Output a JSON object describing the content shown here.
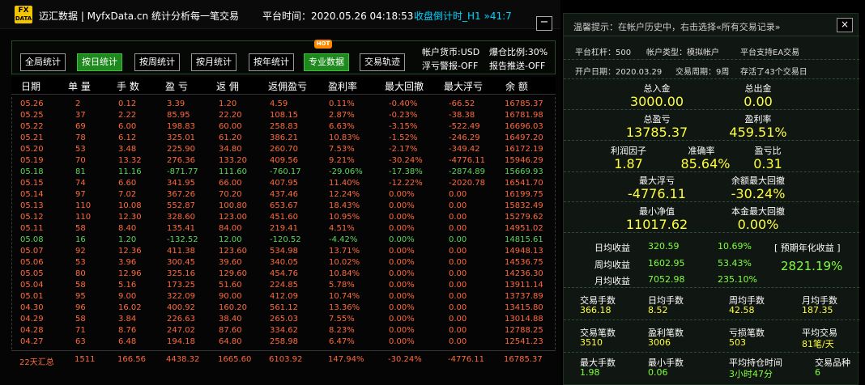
{
  "header": {
    "logo_top": "FX",
    "logo_bottom": "DATA",
    "app_title": "迈汇数据 | MyfxData.cn   统计分析每一笔交易",
    "platform_time": "平台时间：2020.05.26 04:18:53",
    "ea_timer": "收盘倒计时_H1 »41:7",
    "minimize_label": "−"
  },
  "toolbar": {
    "buttons": [
      {
        "label": "全局统计",
        "active": false
      },
      {
        "label": "按日统计",
        "active": true
      },
      {
        "label": "按周统计",
        "active": false
      },
      {
        "label": "按月统计",
        "active": false
      },
      {
        "label": "按年统计",
        "active": false
      },
      {
        "label": "专业数据",
        "active": true
      },
      {
        "label": "交易轨迹",
        "active": false
      }
    ],
    "hot_badge": "HOT",
    "currency": "帐户货币:USD",
    "margin_ratio": "爆仓比例:30%",
    "float_alert": "浮亏警报-OFF",
    "report_push": "报告推送-OFF"
  },
  "columns": [
    "日期",
    "单 量",
    "手 数",
    "盈 亏",
    "返 佣",
    "返佣盈亏",
    "盈利率",
    "最大回撤",
    "最大浮亏",
    "余 额"
  ],
  "rows": [
    {
      "type": "profit",
      "cells": [
        "05.26",
        "2",
        "0.12",
        "3.39",
        "1.20",
        "4.59",
        "0.11%",
        "-0.40%",
        "-66.52",
        "16785.37"
      ]
    },
    {
      "type": "profit",
      "cells": [
        "05.25",
        "37",
        "2.22",
        "85.95",
        "22.20",
        "108.15",
        "2.87%",
        "-0.23%",
        "-38.38",
        "16781.98"
      ]
    },
    {
      "type": "profit",
      "cells": [
        "05.22",
        "69",
        "6.00",
        "198.83",
        "60.00",
        "258.83",
        "6.63%",
        "-3.15%",
        "-522.49",
        "16696.03"
      ]
    },
    {
      "type": "profit",
      "cells": [
        "05.21",
        "78",
        "6.12",
        "325.01",
        "61.20",
        "386.21",
        "10.83%",
        "-1.52%",
        "-246.29",
        "16497.20"
      ]
    },
    {
      "type": "profit",
      "cells": [
        "05.20",
        "53",
        "3.48",
        "225.90",
        "34.80",
        "260.70",
        "7.53%",
        "-2.17%",
        "-349.42",
        "16172.19"
      ]
    },
    {
      "type": "profit",
      "cells": [
        "05.19",
        "70",
        "13.32",
        "276.36",
        "133.20",
        "409.56",
        "9.21%",
        "-30.24%",
        "-4776.11",
        "15946.29"
      ]
    },
    {
      "type": "loss",
      "cells": [
        "05.18",
        "81",
        "11.16",
        "-871.77",
        "111.60",
        "-760.17",
        "-29.06%",
        "-17.38%",
        "-2874.89",
        "15669.93"
      ]
    },
    {
      "type": "profit",
      "cells": [
        "05.15",
        "74",
        "6.60",
        "341.95",
        "66.00",
        "407.95",
        "11.40%",
        "-12.22%",
        "-2020.78",
        "16541.70"
      ]
    },
    {
      "type": "profit",
      "cells": [
        "05.14",
        "97",
        "7.02",
        "367.26",
        "70.20",
        "437.46",
        "12.24%",
        "0.00%",
        "0.00",
        "16199.75"
      ]
    },
    {
      "type": "profit",
      "cells": [
        "05.13",
        "110",
        "10.08",
        "552.87",
        "100.80",
        "653.67",
        "18.43%",
        "0.00%",
        "0.00",
        "15832.49"
      ]
    },
    {
      "type": "profit",
      "cells": [
        "05.12",
        "110",
        "12.30",
        "328.60",
        "123.00",
        "451.60",
        "10.95%",
        "0.00%",
        "0.00",
        "15279.62"
      ]
    },
    {
      "type": "profit",
      "cells": [
        "05.11",
        "58",
        "8.40",
        "135.41",
        "84.00",
        "219.41",
        "4.51%",
        "0.00%",
        "0.00",
        "14951.02"
      ]
    },
    {
      "type": "loss",
      "cells": [
        "05.08",
        "16",
        "1.20",
        "-132.52",
        "12.00",
        "-120.52",
        "-4.42%",
        "0.00%",
        "0.00",
        "14815.61"
      ]
    },
    {
      "type": "profit",
      "cells": [
        "05.07",
        "92",
        "12.36",
        "411.38",
        "123.60",
        "534.98",
        "13.71%",
        "0.00%",
        "0.00",
        "14948.13"
      ]
    },
    {
      "type": "profit",
      "cells": [
        "05.06",
        "53",
        "3.96",
        "300.45",
        "39.60",
        "340.05",
        "10.02%",
        "0.00%",
        "0.00",
        "14536.75"
      ]
    },
    {
      "type": "profit",
      "cells": [
        "05.05",
        "80",
        "12.96",
        "325.16",
        "129.60",
        "454.76",
        "10.84%",
        "0.00%",
        "0.00",
        "14236.30"
      ]
    },
    {
      "type": "profit",
      "cells": [
        "05.04",
        "58",
        "5.16",
        "173.25",
        "51.60",
        "224.85",
        "5.78%",
        "0.00%",
        "0.00",
        "13911.14"
      ]
    },
    {
      "type": "profit",
      "cells": [
        "05.01",
        "95",
        "9.00",
        "322.09",
        "90.00",
        "412.09",
        "10.74%",
        "0.00%",
        "0.00",
        "13737.89"
      ]
    },
    {
      "type": "profit",
      "cells": [
        "04.30",
        "96",
        "16.02",
        "400.92",
        "160.20",
        "561.12",
        "13.36%",
        "0.00%",
        "0.00",
        "13415.80"
      ]
    },
    {
      "type": "profit",
      "cells": [
        "04.29",
        "58",
        "3.84",
        "226.63",
        "38.40",
        "265.03",
        "7.55%",
        "0.00%",
        "0.00",
        "13014.88"
      ]
    },
    {
      "type": "profit",
      "cells": [
        "04.28",
        "71",
        "8.76",
        "247.02",
        "87.60",
        "334.62",
        "8.23%",
        "0.00%",
        "0.00",
        "12788.25"
      ]
    },
    {
      "type": "profit",
      "cells": [
        "04.27",
        "63",
        "6.48",
        "194.18",
        "64.80",
        "258.98",
        "6.47%",
        "0.00%",
        "0.00",
        "12541.23"
      ]
    }
  ],
  "footer": [
    "22天汇总",
    "1511",
    "166.56",
    "4438.32",
    "1665.60",
    "6103.92",
    "147.94%",
    "-30.24%",
    "-4776.11",
    "16785.37"
  ],
  "right": {
    "tip": "温馨提示：在帐户历史中，右击选择«所有交易记录»",
    "close_label": "×",
    "leverage": "平台杠杆：500",
    "account_type": "帐户类型：模拟帐户",
    "ea_support": "平台支持EA交易",
    "open_date": "开户日期：2020.03.29",
    "trade_period": "交易周期：9周",
    "alive": "存活了43个交易日",
    "deposit_label": "总入金",
    "deposit": "3000.00",
    "withdraw_label": "总出金",
    "withdraw": "0.00",
    "profit_label": "总盈亏",
    "profit": "13785.37",
    "profit_rate_label": "盈利率",
    "profit_rate": "459.51%",
    "pf_label": "利润因子",
    "pf": "1.87",
    "acc_label": "准确率",
    "acc": "85.64%",
    "pl_ratio_label": "盈亏比",
    "pl_ratio": "0.31",
    "max_float_label": "最大浮亏",
    "max_float": "-4776.11",
    "max_dd_label": "余额最大回撤",
    "max_dd": "-30.24%",
    "min_equity_label": "最小净值",
    "min_equity": "11017.62",
    "principal_dd_label": "本金最大回撤",
    "principal_dd": "0.00%",
    "daily_label": "日均收益",
    "daily_val": "320.59",
    "daily_pct": "10.69%",
    "weekly_label": "周均收益",
    "weekly_val": "1602.95",
    "weekly_pct": "53.43%",
    "monthly_label": "月均收益",
    "monthly_val": "7052.98",
    "monthly_pct": "235.10%",
    "annual_label": "[ 预期年化收益 ]",
    "annual": "2821.19%",
    "trade_lots_label": "交易手数",
    "trade_lots": "366.18",
    "daily_lots_label": "日均手数",
    "daily_lots": "8.52",
    "weekly_lots_label": "周均手数",
    "weekly_lots": "42.58",
    "monthly_lots_label": "月均手数",
    "monthly_lots": "187.35",
    "trades_label": "交易笔数",
    "trades": "3510",
    "win_trades_label": "盈利笔数",
    "win_trades": "3006",
    "loss_trades_label": "亏损笔数",
    "loss_trades": "503",
    "avg_trades_label": "平均交易",
    "avg_trades": "81笔/天",
    "max_lots_label": "最大手数",
    "max_lots": "1.98",
    "min_lots_label": "最小手数",
    "min_lots": "0.06",
    "avg_hold_label": "平均持仓时间",
    "avg_hold": "3小时47分",
    "symbols_label": "交易品种",
    "symbols": "6"
  }
}
